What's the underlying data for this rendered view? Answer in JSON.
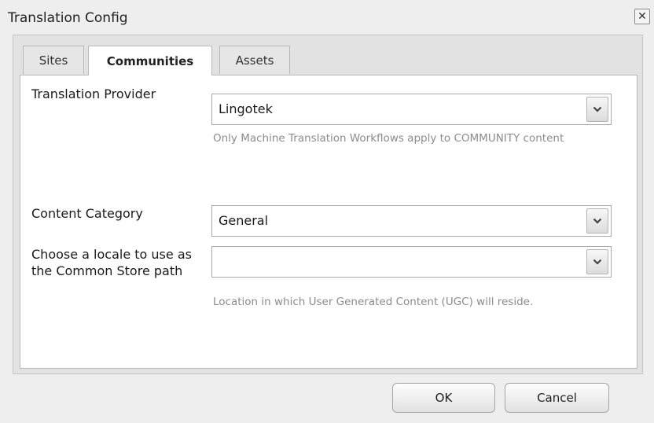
{
  "window": {
    "title": "Translation Config",
    "close_symbol": "✕"
  },
  "tabs": [
    {
      "label": "Sites",
      "active": false
    },
    {
      "label": "Communities",
      "active": true
    },
    {
      "label": "Assets",
      "active": false
    }
  ],
  "form": {
    "translation_provider": {
      "label": "Translation Provider",
      "value": "Lingotek",
      "hint": "Only Machine Translation Workflows apply to COMMUNITY content"
    },
    "content_category": {
      "label": "Content Category",
      "value": "General"
    },
    "common_store_locale": {
      "label": "Choose a locale to use as the Common Store path",
      "value": "",
      "hint": "Location in which User Generated Content (UGC) will reside."
    }
  },
  "buttons": {
    "ok_label": "OK",
    "cancel_label": "Cancel"
  },
  "icons": {
    "close": "close-icon",
    "dropdown": "chevron-down-icon"
  }
}
